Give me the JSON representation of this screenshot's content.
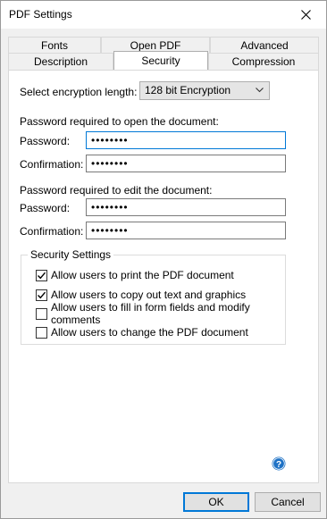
{
  "window": {
    "title": "PDF Settings",
    "close_icon": "close-icon"
  },
  "tabs": {
    "back_row": [
      "Fonts",
      "Open PDF",
      "Advanced"
    ],
    "front_row": [
      "Description",
      "Security",
      "Compression"
    ],
    "active": "Security"
  },
  "encryption": {
    "label": "Select encryption length:",
    "value": "128 bit Encryption"
  },
  "open_password": {
    "heading": "Password required to open the document:",
    "password_label": "Password:",
    "password_value": "••••••••",
    "confirm_label": "Confirmation:",
    "confirm_value": "••••••••"
  },
  "edit_password": {
    "heading": "Password required to edit the document:",
    "password_label": "Password:",
    "password_value": "••••••••",
    "confirm_label": "Confirmation:",
    "confirm_value": "••••••••"
  },
  "security_settings": {
    "legend": "Security Settings",
    "options": [
      {
        "label": "Allow users to print the PDF document",
        "checked": true
      },
      {
        "label": "Allow users to copy out text and graphics",
        "checked": true
      },
      {
        "label": "Allow users to fill in form fields and modify comments",
        "checked": false
      },
      {
        "label": "Allow users to change the PDF document",
        "checked": false
      }
    ]
  },
  "help_icon": "help-icon",
  "buttons": {
    "ok": "OK",
    "cancel": "Cancel"
  },
  "colors": {
    "accent": "#0078d7",
    "help_blue": "#1e72c6"
  }
}
